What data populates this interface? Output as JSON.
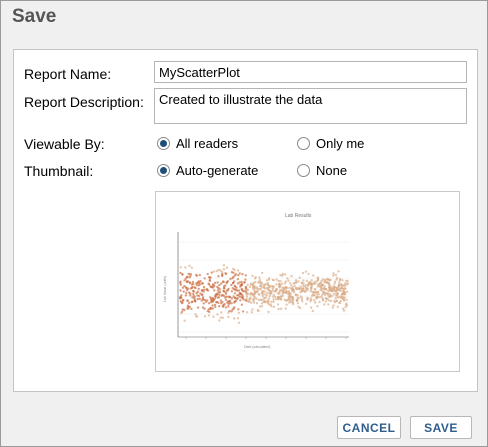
{
  "dialog": {
    "title": "Save"
  },
  "form": {
    "report_name_label": "Report Name:",
    "report_name_value": "MyScatterPlot",
    "report_description_label": "Report Description:",
    "report_description_value": "Created to illustrate the data",
    "viewable_by_label": "Viewable By:",
    "viewable_options": [
      {
        "label": "All readers",
        "checked": true
      },
      {
        "label": "Only me",
        "checked": false
      }
    ],
    "thumbnail_label": "Thumbnail:",
    "thumbnail_options": [
      {
        "label": "Auto-generate",
        "checked": true
      },
      {
        "label": "None",
        "checked": false
      }
    ]
  },
  "thumbnail_preview": {
    "chart_title": "Lab Results",
    "xlabel": "Date (calculated)",
    "ylabel": "Lab Value (units)",
    "point_color": "#d9ab85"
  },
  "buttons": {
    "cancel": "CANCEL",
    "save": "SAVE"
  }
}
